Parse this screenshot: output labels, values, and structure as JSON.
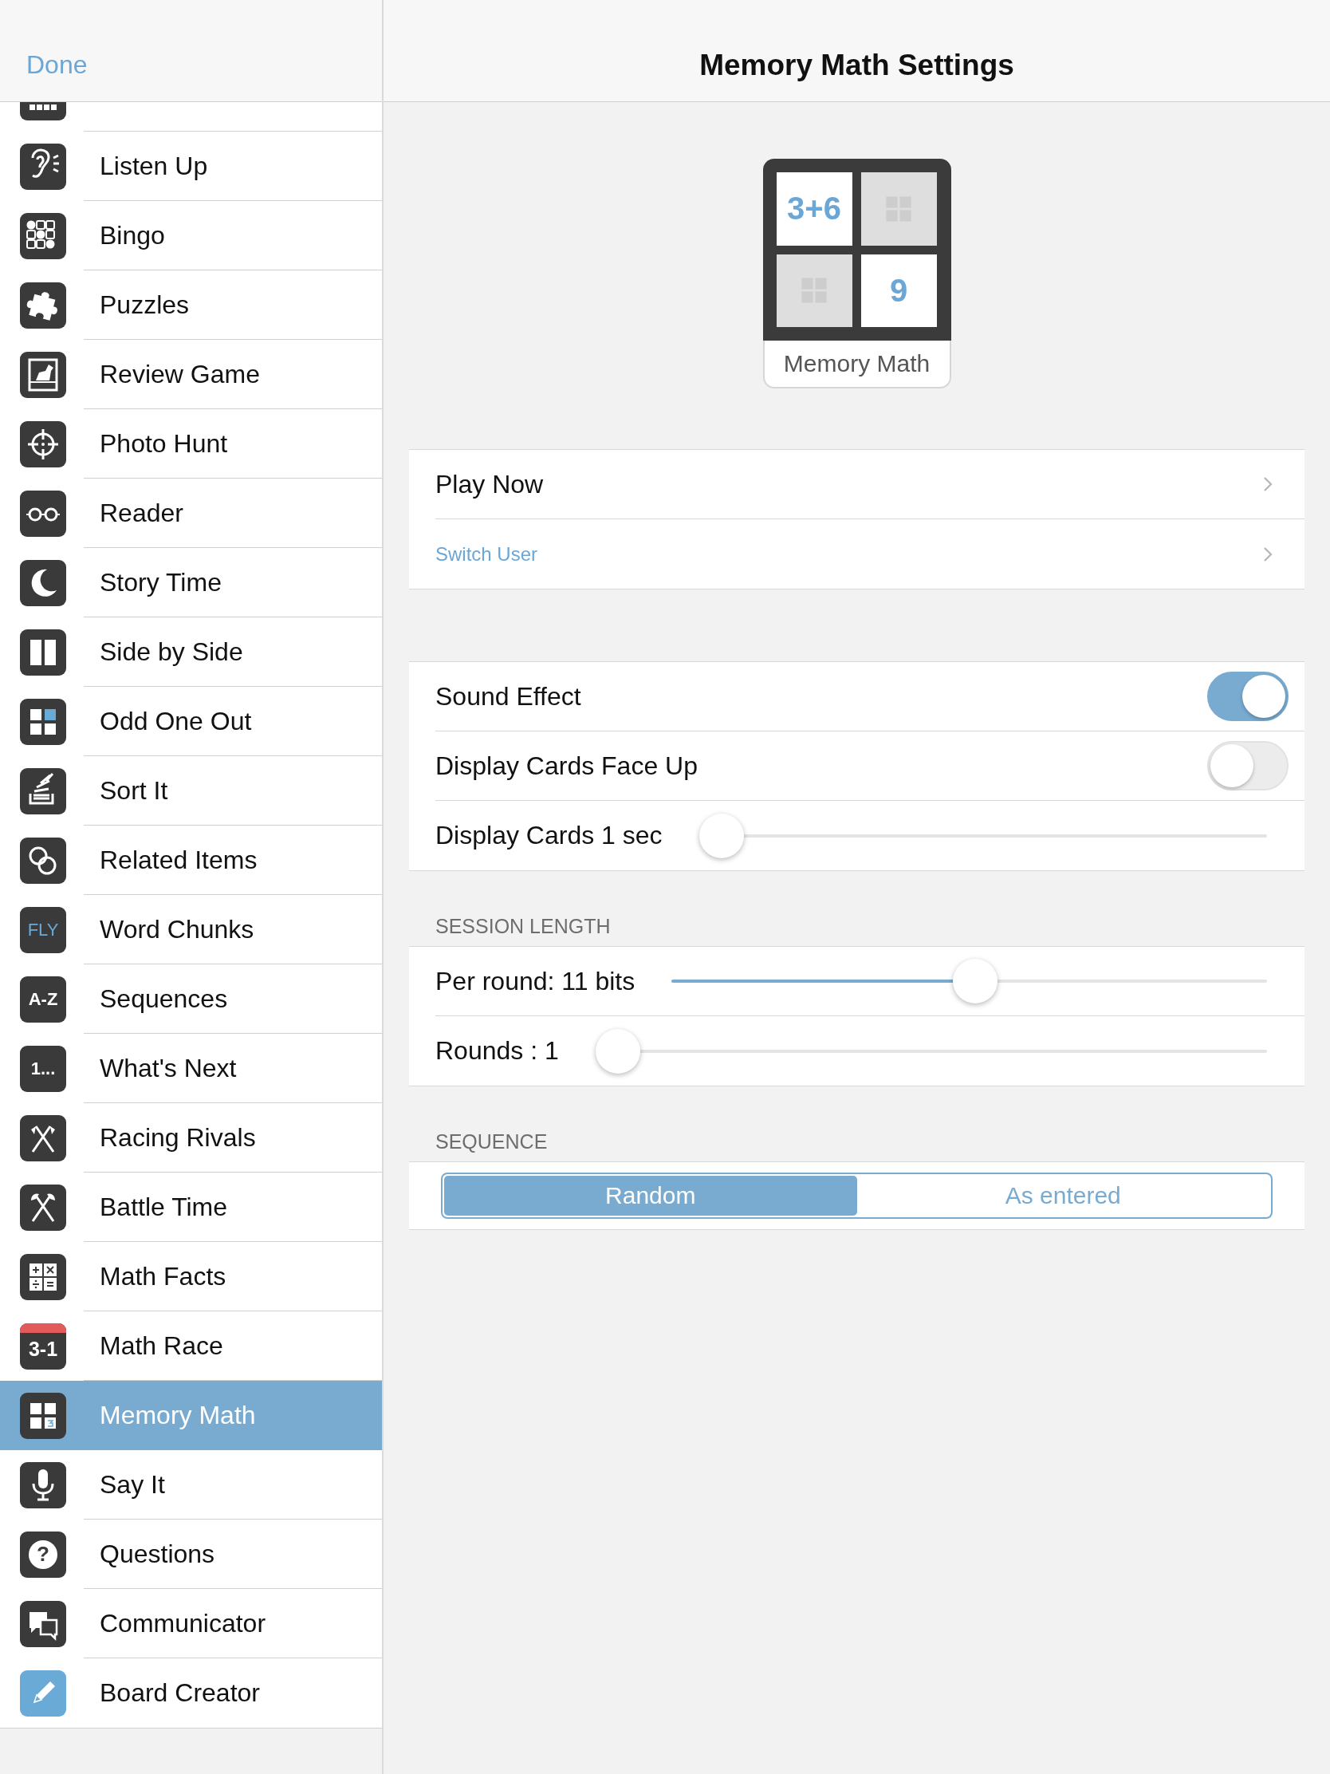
{
  "header": {
    "done": "Done",
    "title": "Memory Math Settings"
  },
  "sidebar": {
    "items": [
      {
        "selected": false
      },
      {
        "label": "Listen Up",
        "selected": false
      },
      {
        "label": "Bingo",
        "selected": false
      },
      {
        "label": "Puzzles",
        "selected": false
      },
      {
        "label": "Review Game",
        "selected": false
      },
      {
        "label": "Photo Hunt",
        "selected": false
      },
      {
        "label": "Reader",
        "selected": false
      },
      {
        "label": "Story Time",
        "selected": false
      },
      {
        "label": "Side by Side",
        "selected": false
      },
      {
        "label": "Odd One Out",
        "selected": false
      },
      {
        "label": "Sort It",
        "selected": false
      },
      {
        "label": "Related Items",
        "selected": false
      },
      {
        "label": "Word Chunks",
        "selected": false,
        "icon_text": "FLY"
      },
      {
        "label": "Sequences",
        "selected": false,
        "icon_text": "A-Z"
      },
      {
        "label": "What's Next",
        "selected": false,
        "icon_text": "1..."
      },
      {
        "label": "Racing Rivals",
        "selected": false
      },
      {
        "label": "Battle Time",
        "selected": false
      },
      {
        "label": "Math Facts",
        "selected": false
      },
      {
        "label": "Math Race",
        "selected": false,
        "icon_text": "3-1"
      },
      {
        "label": "Memory Math",
        "selected": true
      },
      {
        "label": "Say It",
        "selected": false
      },
      {
        "label": "Questions",
        "selected": false,
        "icon_text": "?"
      },
      {
        "label": "Communicator",
        "selected": false
      },
      {
        "label": "Board Creator",
        "selected": false
      }
    ]
  },
  "app_tile": {
    "label": "Memory Math",
    "cards": [
      {
        "kind": "face",
        "text": "3+6"
      },
      {
        "kind": "back"
      },
      {
        "kind": "back"
      },
      {
        "kind": "face",
        "text": "9"
      }
    ]
  },
  "actions": [
    {
      "kind": "primary",
      "label": "Play Now"
    },
    {
      "kind": "link",
      "label": "Switch User"
    }
  ],
  "options": [
    {
      "kind": "toggle",
      "label": "Sound Effect",
      "on": true
    },
    {
      "kind": "toggle",
      "label": "Display Cards Face Up",
      "on": false
    },
    {
      "kind": "slider",
      "label": "Display Cards 1 sec",
      "level": 0
    }
  ],
  "session_length": {
    "heading": "SESSION LENGTH",
    "sliders": [
      {
        "label": "Per round: 11 bits",
        "level": 0.51
      },
      {
        "label": "Rounds : 1",
        "level": 0
      }
    ]
  },
  "sequence": {
    "heading": "SEQUENCE",
    "segments": [
      {
        "label": "Random",
        "selected": true
      },
      {
        "label": "As entered",
        "selected": false
      }
    ]
  }
}
